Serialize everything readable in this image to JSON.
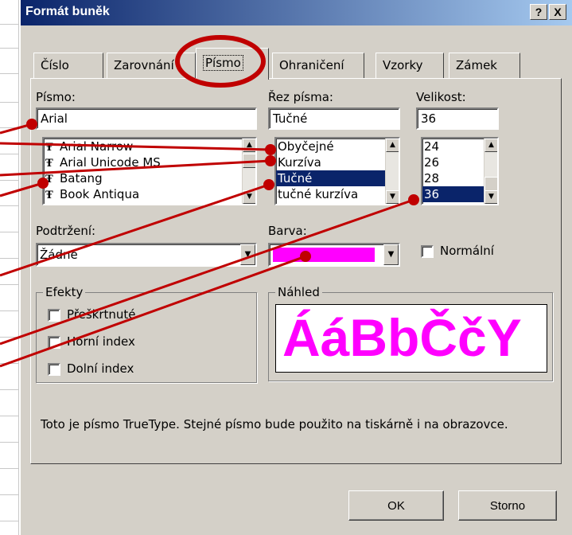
{
  "dialog": {
    "title": "Formát buněk",
    "help_label": "?",
    "close_label": "X"
  },
  "tabs": [
    {
      "label": "Číslo"
    },
    {
      "label": "Zarovnání"
    },
    {
      "label": "Písmo",
      "active": true
    },
    {
      "label": "Ohraničení"
    },
    {
      "label": "Vzorky"
    },
    {
      "label": "Zámek"
    }
  ],
  "font": {
    "label": "Písmo:",
    "value": "Arial",
    "items": [
      "Arial Narrow",
      "Arial Unicode MS",
      "Batang",
      "Book Antiqua"
    ]
  },
  "style": {
    "label": "Řez písma:",
    "value": "Tučné",
    "items": [
      "Obyčejné",
      "Kurzíva",
      "Tučné",
      "tučné kurzíva"
    ],
    "selected": "Tučné"
  },
  "size": {
    "label": "Velikost:",
    "value": "36",
    "items": [
      "24",
      "26",
      "28",
      "36"
    ],
    "selected": "36"
  },
  "underline": {
    "label": "Podtržení:",
    "value": "Žádné"
  },
  "color": {
    "label": "Barva:",
    "swatch": "#ff00ff"
  },
  "normal_checkbox": {
    "label": "Normální"
  },
  "effects": {
    "title": "Efekty",
    "items": [
      "Přeškrtnuté",
      "Horní index",
      "Dolní index"
    ]
  },
  "preview": {
    "title": "Náhled",
    "sample": "ÁáBbČčY",
    "color": "#ff00ff"
  },
  "info_text": "Toto je písmo TrueType. Stejné písmo bude použito na tiskárně i na obrazovce.",
  "buttons": {
    "ok": "OK",
    "cancel": "Storno"
  },
  "annotation_color": "#c00000"
}
